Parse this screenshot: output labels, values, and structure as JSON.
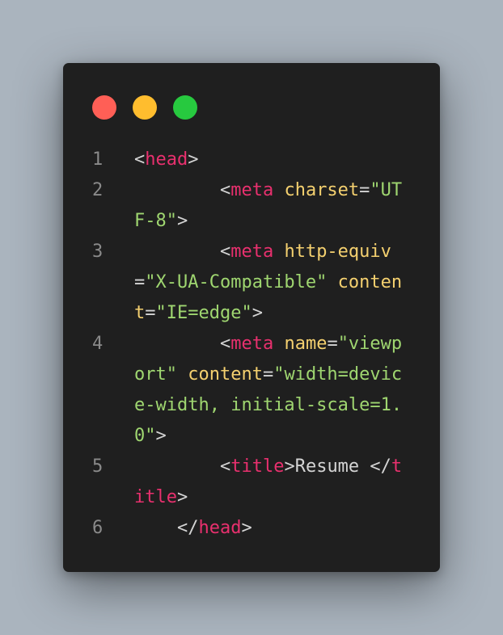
{
  "window": {
    "controls": [
      {
        "name": "close",
        "color": "#ff5f56"
      },
      {
        "name": "minimize",
        "color": "#ffbd2e"
      },
      {
        "name": "maximize",
        "color": "#27c93f"
      }
    ]
  },
  "code": {
    "lines": [
      {
        "number": "1",
        "tokens": [
          {
            "t": "<",
            "k": "punc"
          },
          {
            "t": "head",
            "k": "tag"
          },
          {
            "t": ">",
            "k": "punc"
          }
        ]
      },
      {
        "number": "2",
        "tokens": [
          {
            "t": "        ",
            "k": "txt"
          },
          {
            "t": "<",
            "k": "punc"
          },
          {
            "t": "meta",
            "k": "tag"
          },
          {
            "t": " ",
            "k": "txt"
          },
          {
            "t": "charset",
            "k": "attr"
          },
          {
            "t": "=",
            "k": "punc"
          },
          {
            "t": "\"UTF-8\"",
            "k": "str"
          },
          {
            "t": ">",
            "k": "punc"
          }
        ]
      },
      {
        "number": "3",
        "tokens": [
          {
            "t": "        ",
            "k": "txt"
          },
          {
            "t": "<",
            "k": "punc"
          },
          {
            "t": "meta",
            "k": "tag"
          },
          {
            "t": " ",
            "k": "txt"
          },
          {
            "t": "http-equiv",
            "k": "attr"
          },
          {
            "t": "=",
            "k": "punc"
          },
          {
            "t": "\"X-UA-Compatible\"",
            "k": "str"
          },
          {
            "t": " ",
            "k": "txt"
          },
          {
            "t": "content",
            "k": "attr"
          },
          {
            "t": "=",
            "k": "punc"
          },
          {
            "t": "\"IE=edge\"",
            "k": "str"
          },
          {
            "t": ">",
            "k": "punc"
          }
        ]
      },
      {
        "number": "4",
        "tokens": [
          {
            "t": "        ",
            "k": "txt"
          },
          {
            "t": "<",
            "k": "punc"
          },
          {
            "t": "meta",
            "k": "tag"
          },
          {
            "t": " ",
            "k": "txt"
          },
          {
            "t": "name",
            "k": "attr"
          },
          {
            "t": "=",
            "k": "punc"
          },
          {
            "t": "\"viewport\"",
            "k": "str"
          },
          {
            "t": " ",
            "k": "txt"
          },
          {
            "t": "content",
            "k": "attr"
          },
          {
            "t": "=",
            "k": "punc"
          },
          {
            "t": "\"width=device-width, initial-scale=1.0\"",
            "k": "str"
          },
          {
            "t": ">",
            "k": "punc"
          }
        ]
      },
      {
        "number": "5",
        "tokens": [
          {
            "t": "        ",
            "k": "txt"
          },
          {
            "t": "<",
            "k": "punc"
          },
          {
            "t": "title",
            "k": "tag"
          },
          {
            "t": ">",
            "k": "punc"
          },
          {
            "t": "Resume ",
            "k": "txt"
          },
          {
            "t": "</",
            "k": "punc"
          },
          {
            "t": "title",
            "k": "tag"
          },
          {
            "t": ">",
            "k": "punc"
          }
        ]
      },
      {
        "number": "6",
        "tokens": [
          {
            "t": "    ",
            "k": "txt"
          },
          {
            "t": "</",
            "k": "punc"
          },
          {
            "t": "head",
            "k": "tag"
          },
          {
            "t": ">",
            "k": "punc"
          }
        ]
      }
    ]
  }
}
